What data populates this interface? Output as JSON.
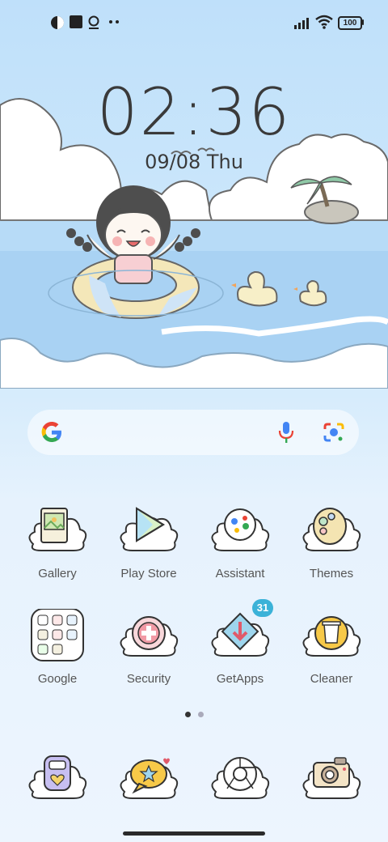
{
  "status_bar": {
    "battery": "100",
    "left_icons": [
      "circle-app-icon",
      "square-app-icon",
      "notification-icon",
      "more-dots-icon"
    ],
    "right_icons": [
      "signal-icon",
      "wifi-icon",
      "battery-icon"
    ]
  },
  "lockscreen": {
    "time": "02:36",
    "date": "09/08 Thu"
  },
  "search": {
    "icons": [
      "google-logo-icon",
      "mic-icon",
      "lens-icon"
    ]
  },
  "apps": [
    {
      "label": "Gallery",
      "icon": "gallery-icon"
    },
    {
      "label": "Play Store",
      "icon": "play-store-icon"
    },
    {
      "label": "Assistant",
      "icon": "assistant-icon"
    },
    {
      "label": "Themes",
      "icon": "themes-icon"
    },
    {
      "label": "Google",
      "icon": "google-folder-icon"
    },
    {
      "label": "Security",
      "icon": "security-icon"
    },
    {
      "label": "GetApps",
      "icon": "getapps-icon",
      "badge": "31"
    },
    {
      "label": "Cleaner",
      "icon": "cleaner-icon"
    }
  ],
  "dock": [
    {
      "icon": "phone-icon"
    },
    {
      "icon": "messages-icon"
    },
    {
      "icon": "chrome-icon"
    },
    {
      "icon": "camera-icon"
    }
  ],
  "page_indicator": {
    "pages": 2,
    "current": 1
  },
  "colors": {
    "accent_badge": "#3bb2d8",
    "sky": "#bfe0fa",
    "sea": "#a8d1f3",
    "cloud": "#ffffff"
  }
}
